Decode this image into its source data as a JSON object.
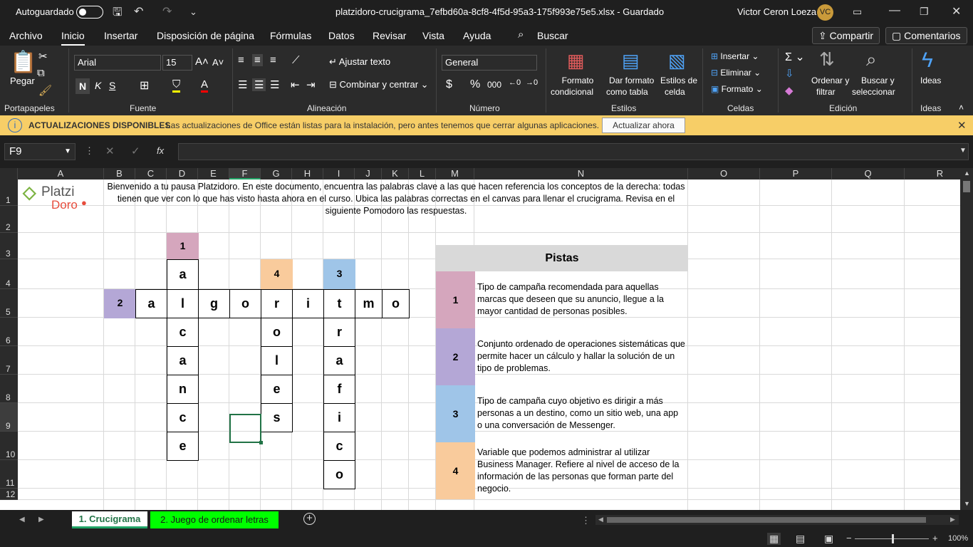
{
  "titlebar": {
    "autosave": "Autoguardado",
    "filename": "platzidoro-crucigrama_7efbd60a-8cf8-4f5d-95a3-175f993e75e5.xlsx  -  Guardado",
    "user": "Victor Ceron Loeza",
    "initials": "VC"
  },
  "menu": {
    "items": [
      "Archivo",
      "Inicio",
      "Insertar",
      "Disposición de página",
      "Fórmulas",
      "Datos",
      "Revisar",
      "Vista",
      "Ayuda"
    ],
    "search": "Buscar",
    "share": "Compartir",
    "comments": "Comentarios"
  },
  "ribbon": {
    "portapapeles": {
      "paste": "Pegar",
      "label": "Portapapeles"
    },
    "fuente": {
      "font": "Arial",
      "size": "15",
      "label": "Fuente",
      "bold": "N",
      "italic": "K",
      "underline": "S"
    },
    "alineacion": {
      "wrap": "Ajustar texto",
      "merge": "Combinar y centrar",
      "label": "Alineación"
    },
    "numero": {
      "format": "General",
      "label": "Número"
    },
    "estilos": {
      "cond1": "Formato",
      "cond2": "condicional",
      "table1": "Dar formato",
      "table2": "como tabla",
      "cell1": "Estilos de",
      "cell2": "celda",
      "label": "Estilos"
    },
    "celdas": {
      "insert": "Insertar",
      "delete": "Eliminar",
      "format": "Formato",
      "label": "Celdas"
    },
    "edicion": {
      "sort1": "Ordenar y",
      "sort2": "filtrar",
      "find1": "Buscar y",
      "find2": "seleccionar",
      "label": "Edición"
    },
    "ideas": {
      "btn": "Ideas",
      "label": "Ideas"
    }
  },
  "notification": {
    "title": "ACTUALIZACIONES DISPONIBLES",
    "message": "Las actualizaciones de Office están listas para la instalación, pero antes tenemos que cerrar algunas aplicaciones.",
    "button": "Actualizar ahora"
  },
  "formula_bar": {
    "name_box": "F9",
    "fx": "fx",
    "value": ""
  },
  "columns": [
    "A",
    "B",
    "C",
    "D",
    "E",
    "F",
    "G",
    "H",
    "I",
    "J",
    "K",
    "L",
    "M",
    "N",
    "O",
    "P",
    "Q",
    "R"
  ],
  "rows": [
    "1",
    "2",
    "3",
    "4",
    "5",
    "6",
    "7",
    "8",
    "9",
    "10",
    "11",
    "12"
  ],
  "sheet": {
    "logo1": "Platzi",
    "logo2": "Doro",
    "intro": "Bienvenido a tu pausa Platzidoro. En este documento, encuentra las palabras clave a las que hacen referencia los conceptos de la derecha: todas tienen que ver con lo que has visto hasta ahora en el curso. Ubica las palabras correctas en el canvas para llenar el crucigrama. Revisa en el siguiente Pomodoro las respuestas.",
    "clues_title": "Pistas",
    "clues": [
      {
        "n": "1",
        "text": "Tipo de campaña recomendada para aquellas marcas que deseen que su anuncio, llegue a la mayor cantidad de personas posibles.",
        "color": "#d5a6bd"
      },
      {
        "n": "2",
        "text": "Conjunto ordenado de operaciones sistemáticas que permite hacer un cálculo y hallar la solución de un tipo de problemas.",
        "color": "#b4a7d6"
      },
      {
        "n": "3",
        "text": "Tipo de campaña cuyo objetivo es dirigir a más personas a un destino, como un sitio web, una app o una conversación de Messenger.",
        "color": "#9fc5e8"
      },
      {
        "n": "4",
        "text": "Variable que podemos administrar al utilizar Business Manager. Refiere al nivel de acceso de la información de las personas que forman parte del negocio.",
        "color": "#f9cb9c"
      }
    ],
    "words": {
      "w1": [
        "a",
        "l",
        "c",
        "a",
        "n",
        "c",
        "e"
      ],
      "w2": [
        "a",
        "l",
        "g",
        "o",
        "r",
        "i",
        "t",
        "m",
        "o"
      ],
      "w3": [
        "t",
        "r",
        "a",
        "f",
        "i",
        "c",
        "o"
      ],
      "w4": [
        "r",
        "o",
        "l",
        "e",
        "s"
      ]
    },
    "markers": {
      "m1": "1",
      "m2": "2",
      "m3": "3",
      "m4": "4"
    }
  },
  "tabs": [
    {
      "label": "1. Crucigrama",
      "active": true
    },
    {
      "label": "2. Juego de ordenar letras",
      "active": false
    }
  ],
  "status": {
    "zoom": "100%"
  }
}
